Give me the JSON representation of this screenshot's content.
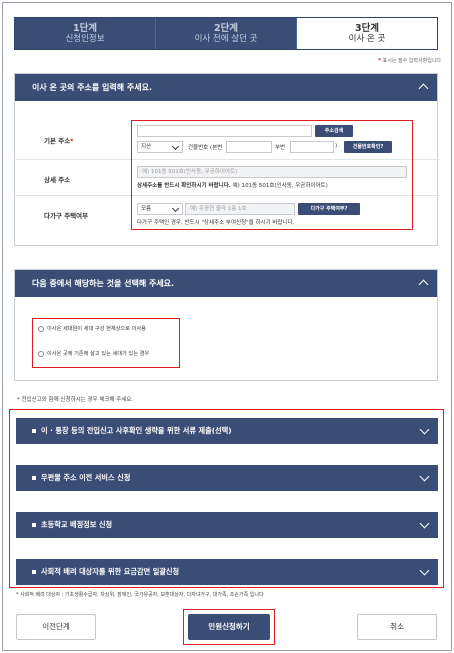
{
  "steps": [
    {
      "num": "1단계",
      "label": "신청인정보",
      "active": false
    },
    {
      "num": "2단계",
      "label": "이사 전에 살던 곳",
      "active": false
    },
    {
      "num": "3단계",
      "label": "이사 온 곳",
      "active": true
    }
  ],
  "required_note": {
    "star": "*",
    "text": "표시는 필수 입력사항입니다"
  },
  "address_panel": {
    "title": "이사 온 곳의 주소를 입력해 주세요.",
    "basic_address": {
      "label": "기본 주소",
      "star": "*",
      "search_button": "주소검색",
      "region_select": "지산",
      "building_label": "건물번호 (본번",
      "sub_label": "부번",
      "close_paren": ")",
      "verify_button": "건물번호확인?"
    },
    "detail_address": {
      "label": "상세 주소",
      "placeholder": "예) 101동 501호(인사동, 우공하이어트)",
      "note": "상세주소를 반드시 확인하시기 바랍니다.",
      "example": "예) 101동 501호(인사동, 우공하이어트)"
    },
    "multi_household": {
      "label": "다가구 주택여부",
      "select_value": "모름",
      "placeholder": "예) 우공현 올라 1층 1호",
      "check_button": "다가구 주택여부?",
      "note": "다가구 주택인 경우, 반드시 \"상세주소 부여신청\"을 하시기 바랍니다."
    }
  },
  "select_panel": {
    "title": "다음 중에서 해당하는 것을 선택해 주세요.",
    "options": [
      "이사온 세대원이 세대 구성 현재상으로 이사용",
      "이사온 곳에 기존에 살고 있는 세대가 있는 경우"
    ]
  },
  "apply_note": "* 전입신고와 함께 신청하시는 경우 체크해 주세요.",
  "services": [
    "이 · 통장 등의 전입신고 사후확인 생략을 위한 서류 제출(선택)",
    "우편물 주소 이전 서비스 신청",
    "초등학교 배정정보 신청",
    "사회적 배려 대상자를 위한 요금감면 일괄신청"
  ],
  "footer_note": "* 사회적 배려 대상자 : 기초생활수급자, 차상위, 장애인, 국가유공자, 보훈대상자, 다자녀가구, 대가족, 조손가족 입니다",
  "buttons": {
    "prev": "이전단계",
    "submit": "민원신청하기",
    "cancel": "취소"
  },
  "colors": {
    "navy": "#3a4d74",
    "highlight": "#e02020"
  }
}
